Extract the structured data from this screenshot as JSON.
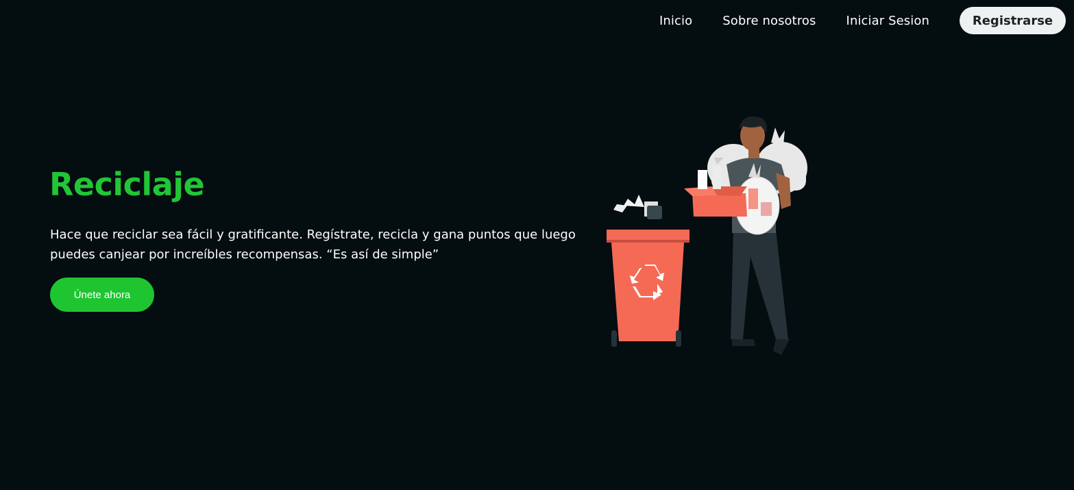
{
  "nav": {
    "links": [
      "Inicio",
      "Sobre nosotros",
      "Iniciar Sesion"
    ],
    "register_label": "Registrarse"
  },
  "hero": {
    "title": "Reciclaje",
    "description": "Hace que reciclar sea fácil y gratificante. Regístrate, recicla y gana puntos que luego puedes canjear por increíbles recompensas. “Es así de simple”",
    "cta_label": "Únete ahora"
  },
  "colors": {
    "background": "#040d10",
    "accent_green": "#22c535",
    "bin_red": "#f56a55"
  },
  "illustration": {
    "icon": "recycling-person-illustration"
  }
}
